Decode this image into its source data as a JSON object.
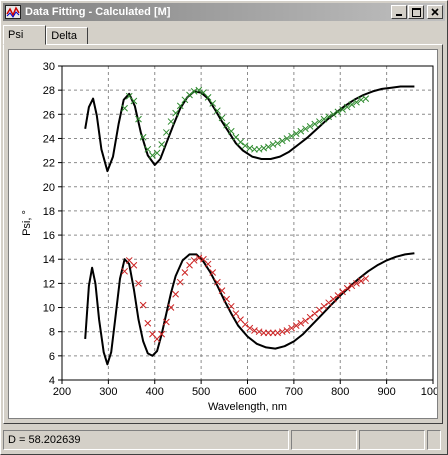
{
  "window": {
    "title": "Data Fitting - Calculated [M]"
  },
  "tabs": [
    {
      "label": "Psi"
    },
    {
      "label": "Delta"
    }
  ],
  "status": {
    "text": "D = 58.202639"
  },
  "chart_data": {
    "type": "line",
    "xlabel": "Wavelength, nm",
    "ylabel": "Psi, °",
    "xlim": [
      200,
      1000
    ],
    "ylim": [
      4,
      30
    ],
    "xticks": [
      200,
      300,
      400,
      500,
      600,
      700,
      800,
      900,
      1000
    ],
    "yticks": [
      4,
      6,
      8,
      10,
      12,
      14,
      16,
      18,
      20,
      22,
      24,
      26,
      28,
      30
    ],
    "grid": true,
    "series": [
      {
        "kind": "line",
        "color": "#000000",
        "x": [
          250,
          258,
          267,
          275,
          285,
          298,
          310,
          322,
          333,
          345,
          357,
          370,
          385,
          400,
          412,
          425,
          440,
          455,
          470,
          485,
          500,
          515,
          530,
          545,
          560,
          575,
          590,
          610,
          630,
          650,
          670,
          690,
          710,
          730,
          750,
          770,
          790,
          810,
          830,
          850,
          870,
          890,
          910,
          930,
          960
        ],
        "y": [
          24.8,
          26.6,
          27.3,
          25.9,
          23.1,
          21.3,
          22.5,
          25.2,
          27.2,
          27.7,
          26.7,
          24.5,
          22.6,
          21.8,
          22.3,
          23.6,
          25.1,
          26.5,
          27.4,
          27.9,
          27.8,
          27.3,
          26.4,
          25.4,
          24.5,
          23.6,
          23.0,
          22.5,
          22.3,
          22.3,
          22.5,
          22.9,
          23.5,
          24.1,
          24.8,
          25.5,
          26.1,
          26.7,
          27.2,
          27.6,
          27.9,
          28.1,
          28.2,
          28.3,
          28.3
        ]
      },
      {
        "kind": "markers",
        "color": "#2e8b2e",
        "x": [
          335,
          345,
          355,
          365,
          375,
          385,
          395,
          405,
          415,
          425,
          435,
          445,
          455,
          465,
          475,
          485,
          495,
          505,
          515,
          525,
          535,
          545,
          555,
          565,
          575,
          585,
          595,
          605,
          615,
          625,
          635,
          645,
          655,
          665,
          675,
          685,
          695,
          705,
          715,
          725,
          735,
          745,
          755,
          765,
          775,
          785,
          795,
          805,
          815,
          825,
          835,
          845,
          855
        ],
        "y": [
          26.5,
          27.5,
          27.1,
          25.6,
          24.1,
          23.1,
          22.6,
          22.8,
          23.5,
          24.5,
          25.4,
          26.1,
          26.7,
          27.2,
          27.6,
          27.9,
          28.0,
          27.8,
          27.4,
          26.9,
          26.3,
          25.7,
          25.1,
          24.6,
          24.1,
          23.7,
          23.4,
          23.2,
          23.1,
          23.1,
          23.2,
          23.3,
          23.5,
          23.6,
          23.8,
          24.0,
          24.2,
          24.4,
          24.6,
          24.8,
          25.0,
          25.2,
          25.4,
          25.6,
          25.8,
          26.0,
          26.2,
          26.4,
          26.6,
          26.8,
          27.0,
          27.2,
          27.3
        ]
      },
      {
        "kind": "line",
        "color": "#000000",
        "x": [
          250,
          258,
          265,
          272,
          280,
          290,
          298,
          306,
          315,
          325,
          335,
          345,
          355,
          365,
          375,
          385,
          395,
          405,
          415,
          425,
          435,
          445,
          460,
          475,
          490,
          505,
          520,
          535,
          550,
          565,
          580,
          600,
          620,
          640,
          660,
          680,
          700,
          720,
          740,
          760,
          780,
          800,
          820,
          840,
          860,
          880,
          900,
          920,
          940,
          960
        ],
        "y": [
          7.4,
          11.8,
          13.3,
          12.0,
          9.0,
          6.3,
          5.3,
          6.3,
          9.1,
          12.4,
          14.0,
          13.6,
          11.5,
          9.0,
          7.2,
          6.2,
          6.0,
          6.4,
          7.8,
          9.5,
          11.2,
          12.6,
          13.9,
          14.4,
          14.4,
          13.8,
          12.9,
          11.8,
          10.6,
          9.5,
          8.5,
          7.6,
          7.0,
          6.7,
          6.6,
          6.8,
          7.2,
          7.8,
          8.6,
          9.4,
          10.2,
          11.0,
          11.7,
          12.4,
          13.0,
          13.5,
          13.9,
          14.2,
          14.4,
          14.5
        ]
      },
      {
        "kind": "markers",
        "color": "#cc2222",
        "x": [
          335,
          345,
          355,
          365,
          375,
          385,
          395,
          405,
          415,
          425,
          435,
          445,
          455,
          465,
          475,
          485,
          495,
          505,
          515,
          525,
          535,
          545,
          555,
          565,
          575,
          585,
          595,
          605,
          615,
          625,
          635,
          645,
          655,
          665,
          675,
          685,
          695,
          705,
          715,
          725,
          735,
          745,
          755,
          765,
          775,
          785,
          795,
          805,
          815,
          825,
          835,
          845,
          855
        ],
        "y": [
          13.0,
          13.9,
          13.5,
          12.0,
          10.2,
          8.7,
          7.8,
          7.4,
          7.8,
          8.8,
          10.0,
          11.1,
          12.1,
          12.9,
          13.5,
          13.9,
          14.1,
          14.0,
          13.6,
          12.9,
          12.1,
          11.4,
          10.7,
          10.1,
          9.5,
          9.0,
          8.6,
          8.3,
          8.1,
          8.0,
          7.9,
          7.9,
          7.9,
          7.9,
          8.0,
          8.1,
          8.3,
          8.5,
          8.7,
          8.9,
          9.2,
          9.5,
          9.8,
          10.1,
          10.4,
          10.7,
          11.0,
          11.3,
          11.6,
          11.8,
          12.0,
          12.2,
          12.4
        ]
      }
    ]
  }
}
